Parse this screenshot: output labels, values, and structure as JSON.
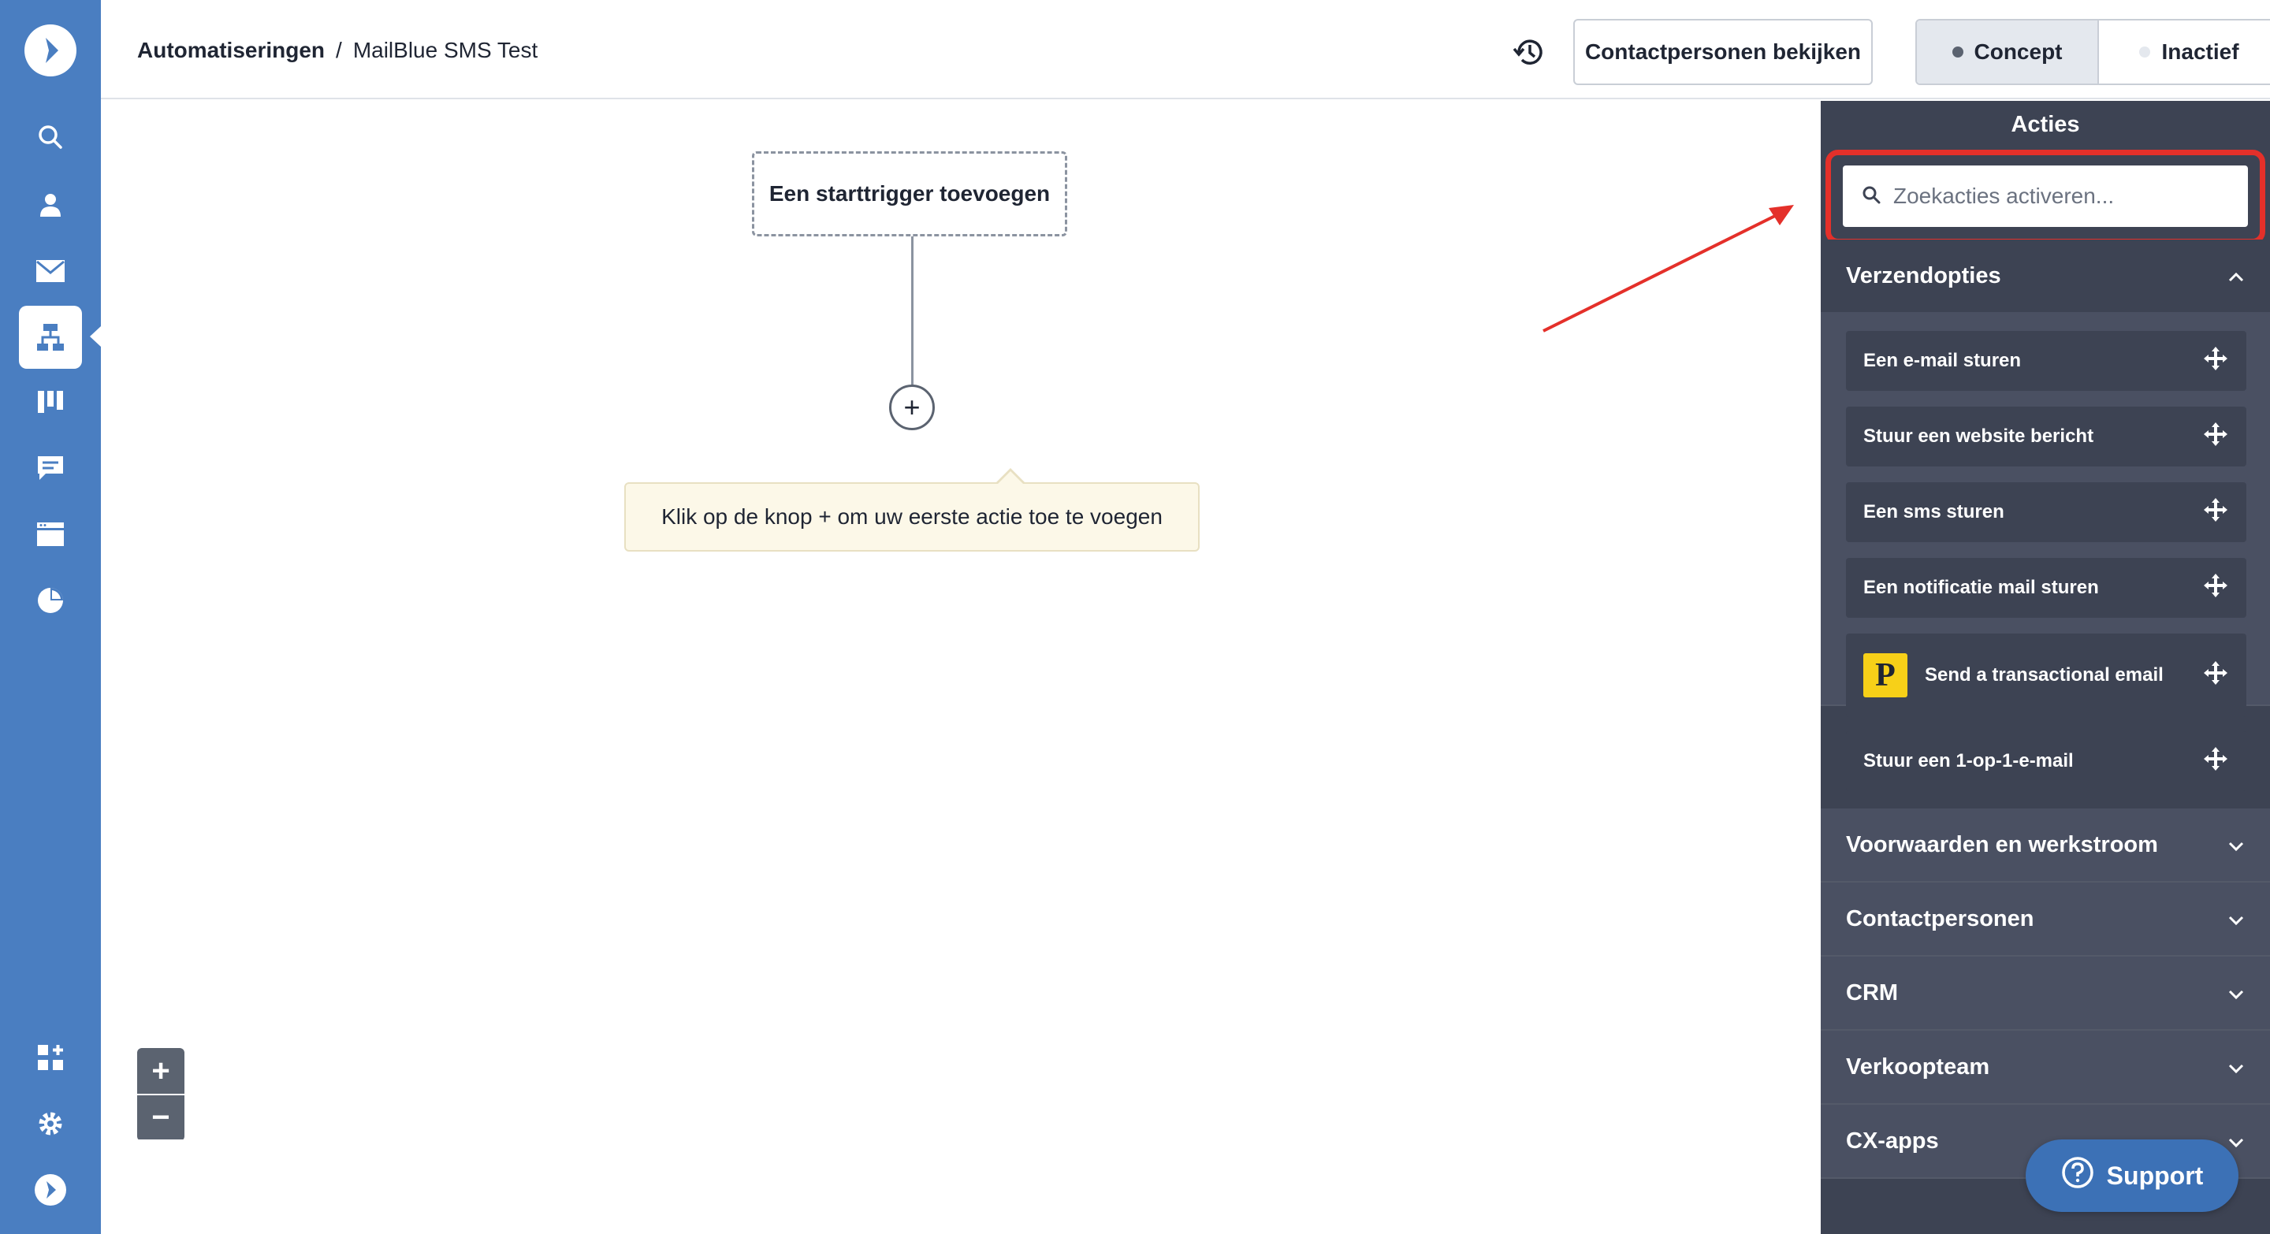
{
  "breadcrumb": {
    "root": "Automatiseringen",
    "separator": "/",
    "current": "MailBlue SMS Test"
  },
  "header": {
    "contacts_button": "Contactpersonen bekijken",
    "status": {
      "concept": "Concept",
      "inactive": "Inactief"
    }
  },
  "canvas": {
    "trigger_label": "Een starttrigger toevoegen",
    "add_button": "+",
    "tooltip": "Klik op de knop + om uw eerste actie toe te voegen",
    "zoom_in": "+",
    "zoom_out": "−"
  },
  "panel": {
    "title": "Acties",
    "search_placeholder": "Zoekacties activeren...",
    "open_section": {
      "title": "Verzendopties",
      "actions": [
        "Een e-mail sturen",
        "Stuur een website bericht",
        "Een sms sturen",
        "Een notificatie mail sturen",
        "Send a transactional email",
        "Stuur een 1-op-1-e-mail"
      ],
      "transactional_logo": "P"
    },
    "sections": [
      "Voorwaarden en werkstroom",
      "Contactpersonen",
      "CRM",
      "Verkoopteam",
      "CX-apps"
    ]
  },
  "support_label": "Support",
  "colors": {
    "nav": "#4a7ec1",
    "panel": "#3d4353",
    "highlight": "#e4302a",
    "concept_dot": "#5b6370",
    "inactive_dot": "#e4e8ee"
  },
  "icons": {
    "nav": [
      "logo-icon",
      "search-icon",
      "user-icon",
      "envelope-icon",
      "automation-icon",
      "pipeline-icon",
      "chat-icon",
      "site-icon",
      "report-icon",
      "apps-icon",
      "settings-icon",
      "brand-icon"
    ]
  }
}
